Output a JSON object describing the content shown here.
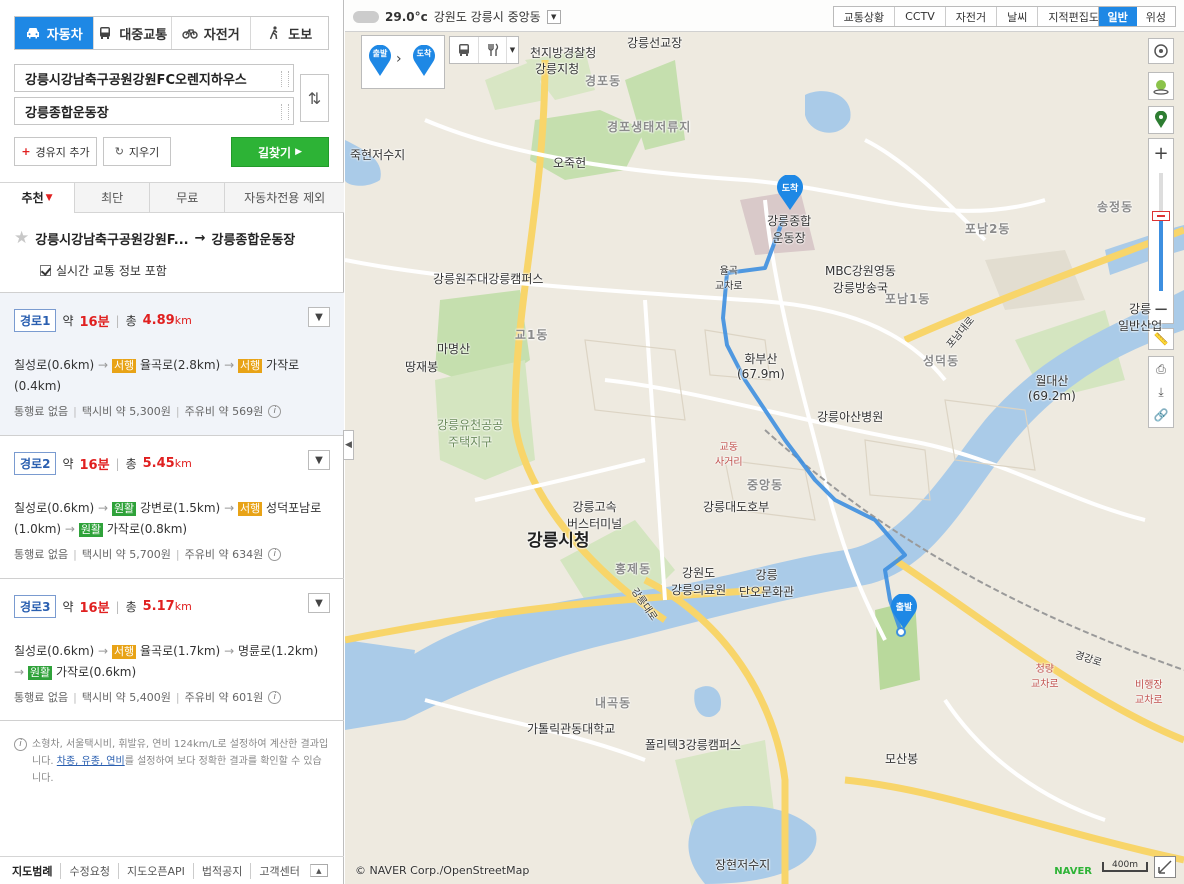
{
  "modes": [
    {
      "label": "자동차",
      "icon": "car-icon",
      "active": true
    },
    {
      "label": "대중교통",
      "icon": "bus-icon",
      "active": false
    },
    {
      "label": "자전거",
      "icon": "bicycle-icon",
      "active": false
    },
    {
      "label": "도보",
      "icon": "walk-icon",
      "active": false
    }
  ],
  "search": {
    "origin": "강릉시강남축구공원강원FC오렌지하우스",
    "destination": "강릉종합운동장",
    "add_waypoint": "경유지 추가",
    "clear": "지우기",
    "find_route": "길찾기"
  },
  "tabs": [
    "추천",
    "최단",
    "무료",
    "자동차전용 제외"
  ],
  "route_header": {
    "from": "강릉시강남축구공원강원F...",
    "arrow": "→",
    "to": "강릉종합운동장",
    "realtime": "실시간 교통 정보 포함"
  },
  "routes": [
    {
      "name": "경로1",
      "time_prefix": "약",
      "time": "16분",
      "dist_prefix": "총",
      "distance": "4.89",
      "unit": "km",
      "segments": [
        {
          "tag": "",
          "tagcolor": "",
          "text": "칠성로(0.6km)"
        },
        {
          "tag": "서행",
          "tagcolor": "y",
          "text": "율곡로(2.8km)"
        },
        {
          "tag": "서행",
          "tagcolor": "y",
          "text": "가작로(0.4km)"
        }
      ],
      "toll": "통행료 없음",
      "taxi": "택시비 약 5,300원",
      "fuel": "주유비 약 569원"
    },
    {
      "name": "경로2",
      "time_prefix": "약",
      "time": "16분",
      "dist_prefix": "총",
      "distance": "5.45",
      "unit": "km",
      "segments": [
        {
          "tag": "",
          "tagcolor": "",
          "text": "칠성로(0.6km)"
        },
        {
          "tag": "원활",
          "tagcolor": "g",
          "text": "강변로(1.5km)"
        },
        {
          "tag": "서행",
          "tagcolor": "y",
          "text": "성덕포남로(1.0km)"
        },
        {
          "tag": "원활",
          "tagcolor": "g",
          "text": "가작로(0.8km)"
        }
      ],
      "toll": "통행료 없음",
      "taxi": "택시비 약 5,700원",
      "fuel": "주유비 약 634원"
    },
    {
      "name": "경로3",
      "time_prefix": "약",
      "time": "16분",
      "dist_prefix": "총",
      "distance": "5.17",
      "unit": "km",
      "segments": [
        {
          "tag": "",
          "tagcolor": "",
          "text": "칠성로(0.6km)"
        },
        {
          "tag": "서행",
          "tagcolor": "y",
          "text": "율곡로(1.7km)"
        },
        {
          "tag": "",
          "tagcolor": "",
          "text": "명륜로(1.2km)"
        },
        {
          "tag": "원활",
          "tagcolor": "g",
          "text": "가작로(0.6km)"
        }
      ],
      "toll": "통행료 없음",
      "taxi": "택시비 약 5,400원",
      "fuel": "주유비 약 601원"
    }
  ],
  "note": {
    "text1": "소형차, 서울택시비, 휘발유, 연비 124km/L로 설정하여 계산한 결과입니다.",
    "link": "차종, 유종, 연비",
    "text2": "를 설정하여 보다 정확한 결과를 확인할 수 있습니다."
  },
  "footer": [
    "지도범례",
    "수정요청",
    "지도오픈API",
    "법적공지",
    "고객센터"
  ],
  "map": {
    "weather_temp": "29.0°c",
    "weather_location": "강원도 강릉시 중앙동",
    "layers": [
      "교통상황",
      "CCTV",
      "자전거",
      "날씨",
      "지적편집도"
    ],
    "basetypes": [
      "일반",
      "위성"
    ],
    "start_pin": "출발",
    "end_pin": "도착",
    "copyright": "© NAVER Corp./OpenStreetMap",
    "brand": "NAVER",
    "scale": "400m",
    "route_color": "#3d8fe0",
    "labels": {
      "poi_1": "천지방경찰청",
      "poi_2": "강릉지청",
      "poi_3": "강릉선교장",
      "poi_4": "경포동",
      "poi_5": "경포생태저류지",
      "poi_6": "죽현저수지",
      "poi_7": "오죽헌",
      "poi_8": "강릉종합\n운동장",
      "poi_9": "포남2동",
      "poi_10": "송정동",
      "poi_11": "강릉원주대강릉캠퍼스",
      "poi_12": "율곡\n교차로",
      "poi_13": "MBC강원영동\n강릉방송국",
      "poi_14": "포남1동",
      "poi_15": "포남대로",
      "poi_16": "교1동",
      "poi_17": "마명산",
      "poi_18": "땅재봉",
      "poi_19": "화부산\n(67.9m)",
      "poi_20": "성덕동",
      "poi_21": "월대산\n(69.2m)",
      "poi_22": "강릉\n일반산업",
      "poi_23": "강릉아산병원",
      "poi_24": "강릉유천공공\n주택지구",
      "poi_25": "교동\n사거리",
      "poi_26": "중앙동",
      "poi_27": "강릉고속\n버스터미널",
      "poi_28": "강릉대도호부",
      "poi_29": "강릉시청",
      "poi_30": "홍제동",
      "poi_31": "강원도\n강릉의료원",
      "poi_32": "강릉\n단오문화관",
      "poi_33": "청량\n교차로",
      "poi_34": "비행장\n교차로",
      "poi_35": "내곡동",
      "poi_36": "가톨릭관동대학교",
      "poi_37": "폴리텍3강릉캠퍼스",
      "poi_38": "모산봉",
      "poi_39": "장현저수지",
      "poi_40": "경강로",
      "poi_41": "강릉대로"
    }
  }
}
